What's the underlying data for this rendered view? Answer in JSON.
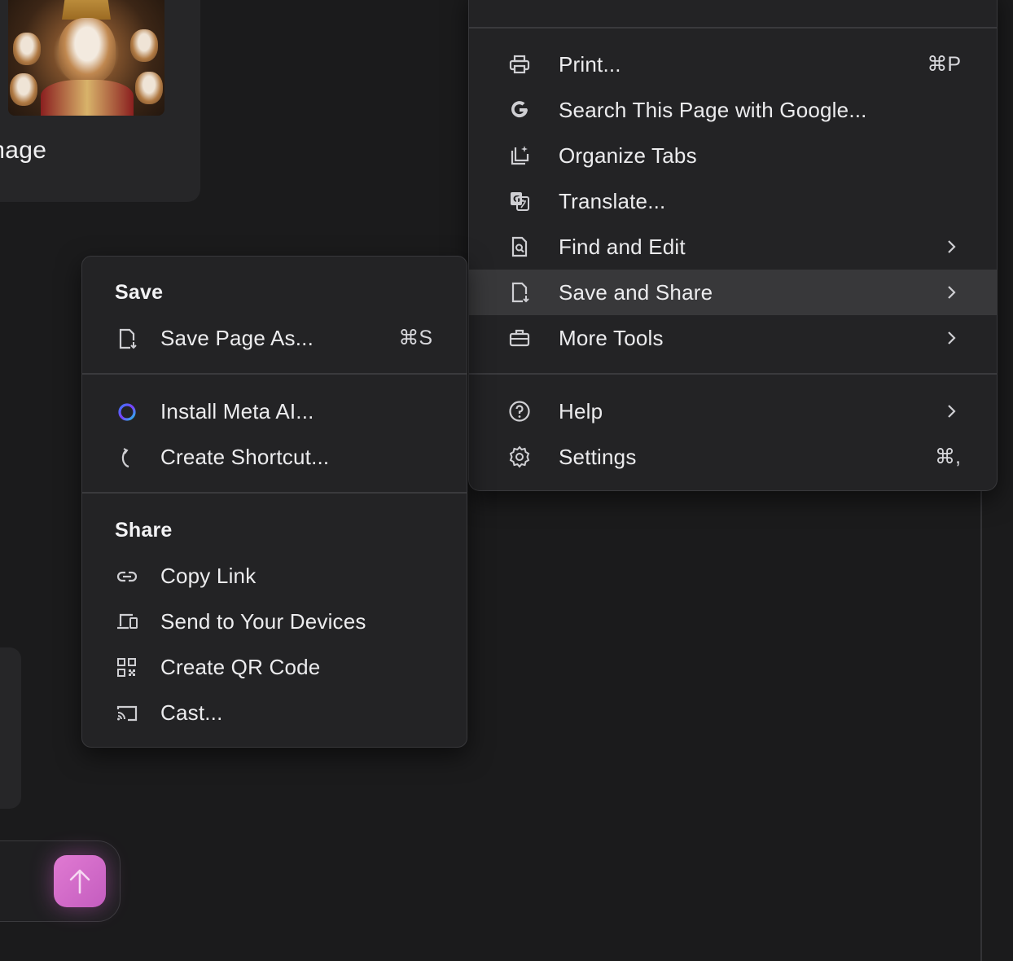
{
  "background": {
    "card_caption": "image"
  },
  "main_menu": {
    "items": [
      {
        "label": "Print...",
        "shortcut": "⌘P",
        "icon": "printer-icon"
      },
      {
        "label": "Search This Page with Google...",
        "icon": "google-icon"
      },
      {
        "label": "Organize Tabs",
        "icon": "organize-tabs-icon"
      },
      {
        "label": "Translate...",
        "icon": "translate-icon"
      },
      {
        "label": "Find and Edit",
        "icon": "find-page-icon",
        "submenu": true
      },
      {
        "label": "Save and Share",
        "icon": "save-page-icon",
        "submenu": true,
        "active": true
      },
      {
        "label": "More Tools",
        "icon": "toolbox-icon",
        "submenu": true
      },
      {
        "label": "Help",
        "icon": "help-icon",
        "submenu": true
      },
      {
        "label": "Settings",
        "shortcut": "⌘,",
        "icon": "gear-icon"
      }
    ]
  },
  "save_share_menu": {
    "save_section_title": "Save",
    "save_page_as": {
      "label": "Save Page As...",
      "shortcut": "⌘S"
    },
    "install_app": {
      "label": "Install Meta AI..."
    },
    "create_shortcut": {
      "label": "Create Shortcut..."
    },
    "share_section_title": "Share",
    "copy_link": {
      "label": "Copy Link"
    },
    "send_to_devices": {
      "label": "Send to Your Devices"
    },
    "create_qr": {
      "label": "Create QR Code"
    },
    "cast": {
      "label": "Cast..."
    }
  },
  "colors": {
    "background": "#1b1b1c",
    "menu_bg": "#232325",
    "active_row": "#38383a",
    "send_button": "#d46bc9"
  }
}
